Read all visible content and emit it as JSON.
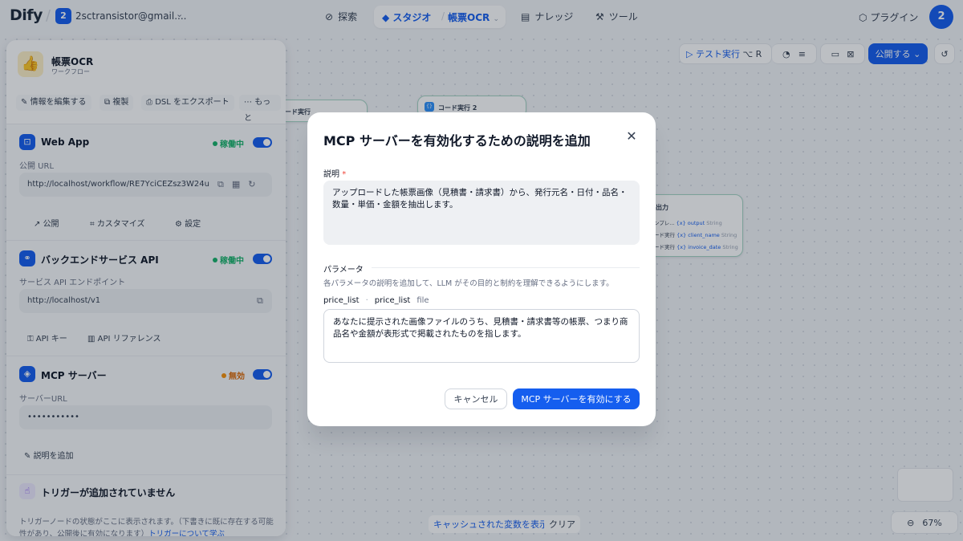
{
  "header": {
    "logo": "Dify",
    "workspace_badge": "2",
    "workspace_name": "2sctransistor@gmail....",
    "nav_explore": "探索",
    "nav_studio": "スタジオ",
    "nav_app": "帳票OCR",
    "nav_knowledge": "ナレッジ",
    "nav_tools": "ツール",
    "plugins": "プラグイン",
    "avatar": "2"
  },
  "canvas": {
    "test_run": "テスト実行",
    "test_shortcut": "⌥ R",
    "publish": "公開する",
    "node_code1": "ード実行",
    "node_code2": "コード実行 2",
    "node_output": "出力",
    "out_rows": [
      {
        "src": "ンプレ...",
        "var": "{x} output",
        "type": "String"
      },
      {
        "src": "ード実行",
        "var": "{x} client_name",
        "type": "String"
      },
      {
        "src": "ード実行",
        "var": "{x} invoice_date",
        "type": "String"
      }
    ],
    "cached_vars": "キャッシュされた変数を表示",
    "clear": "クリア",
    "zoom": "67%"
  },
  "panel": {
    "app_icon": "👍",
    "app_name": "帳票OCR",
    "app_type": "ワークフロー",
    "actions": [
      "情報を編集する",
      "複製",
      "DSL をエクスポート",
      "もっと"
    ],
    "webapp": {
      "title": "Web App",
      "status": "稼働中",
      "url_label": "公開 URL",
      "url": "http://localhost/workflow/RE7YciCEZsz3W24u",
      "links": [
        "公開",
        "カスタマイズ",
        "設定"
      ]
    },
    "api": {
      "title": "バックエンドサービス API",
      "status": "稼働中",
      "endpoint_label": "サービス API エンドポイント",
      "endpoint": "http://localhost/v1",
      "links": [
        "API キー",
        "API リファレンス"
      ]
    },
    "mcp": {
      "title": "MCP サーバー",
      "status": "無効",
      "url_label": "サーバーURL",
      "url": "•••••••••••",
      "add_desc": "説明を追加"
    },
    "trigger": {
      "title": "トリガーが追加されていません",
      "desc": "トリガーノードの状態がここに表示されます。（下書きに既に存在する可能性があり、公開後に有効になります）",
      "link": "トリガーについて学ぶ"
    }
  },
  "modal": {
    "title": "MCP サーバーを有効化するための説明を追加",
    "desc_label": "説明",
    "desc_required": "*",
    "desc_value": "アップロードした帳票画像（見積書・請求書）から、発行元名・日付・品名・数量・単価・金額を抽出します。",
    "params_label": "パラメータ",
    "params_hint": "各パラメータの説明を追加して、LLM がその目的と制約を理解できるようにします。",
    "param_name": "price_list",
    "param_sep": "·",
    "param_label": "price_list",
    "param_type": "file",
    "param_value": "あなたに提示された画像ファイルのうち、見積書・請求書等の帳票、つまり商品名や金額が表形式で掲載されたものを指します。",
    "cancel": "キャンセル",
    "confirm": "MCP サーバーを有効にする"
  },
  "colors": {
    "accent": "#155eef",
    "success": "#17b26a",
    "warning": "#f79009"
  }
}
